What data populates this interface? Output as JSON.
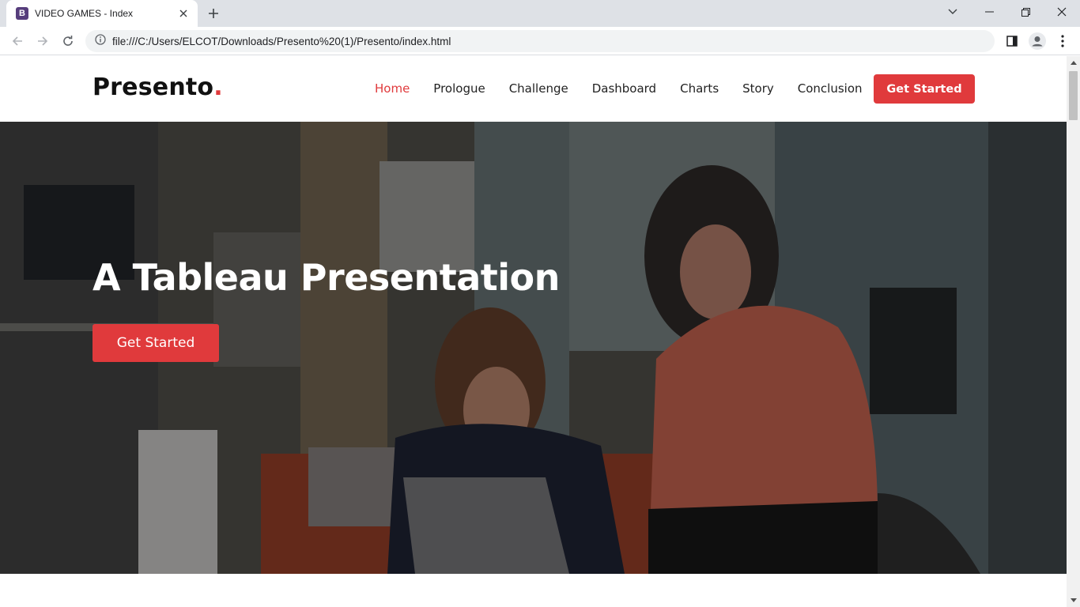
{
  "browser": {
    "tab_title": "VIDEO GAMES - Index",
    "favicon_letter": "B",
    "url": "file:///C:/Users/ELCOT/Downloads/Presento%20(1)/Presento/index.html"
  },
  "colors": {
    "accent": "#e03a3c",
    "favicon": "#563d7c"
  },
  "header": {
    "logo": "Presento",
    "logo_dot": ".",
    "nav": [
      "Home",
      "Prologue",
      "Challenge",
      "Dashboard",
      "Charts",
      "Story",
      "Conclusion"
    ],
    "active_nav": "Home",
    "cta_label": "Get Started"
  },
  "hero": {
    "title": "A Tableau Presentation",
    "cta_label": "Get Started"
  }
}
